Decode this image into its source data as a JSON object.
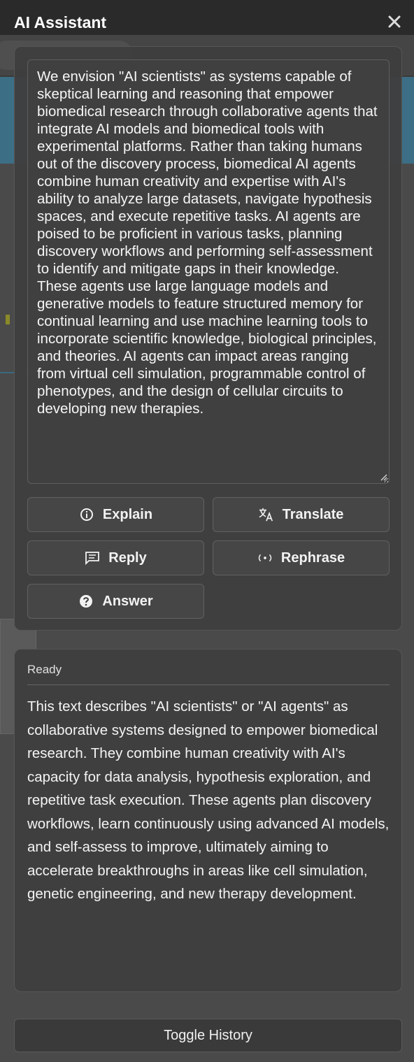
{
  "window": {
    "title": "AI Assistant",
    "close_icon": "close-icon"
  },
  "input": {
    "text": "We envision \"AI scientists\" as systems capable of skeptical learning and reasoning that empower biomedical research through collaborative agents that integrate AI models and biomedical tools with experimental platforms. Rather than taking humans out of the discovery process, biomedical AI agents combine human creativity and expertise with AI's ability to analyze large datasets, navigate hypothesis spaces, and execute repetitive tasks. AI agents are poised to be proficient in various tasks, planning discovery workflows and performing self-assessment to identify and mitigate gaps in their knowledge. These agents use large language models and generative models to feature structured memory for continual learning and use machine learning tools to incorporate scientific knowledge, biological principles, and theories. AI agents can impact areas ranging from virtual cell simulation, programmable control of phenotypes, and the design of cellular circuits to developing new therapies."
  },
  "actions": {
    "explain": {
      "label": "Explain",
      "icon": "info-icon"
    },
    "translate": {
      "label": "Translate",
      "icon": "translate-icon"
    },
    "reply": {
      "label": "Reply",
      "icon": "message-icon"
    },
    "rephrase": {
      "label": "Rephrase",
      "icon": "rephrase-icon"
    },
    "answer": {
      "label": "Answer",
      "icon": "question-icon"
    }
  },
  "output": {
    "status": "Ready",
    "text": "This text describes \"AI scientists\" or \"AI agents\" as collaborative systems designed to empower biomedical research. They combine human creativity with AI's capacity for data analysis, hypothesis exploration, and repetitive task execution. These agents plan discovery workflows, learn continuously using advanced AI models, and self-assess to improve, ultimately aiming to accelerate breakthroughs in areas like cell simulation, genetic engineering, and new therapy development."
  },
  "footer": {
    "toggle_history_label": "Toggle History"
  },
  "colors": {
    "panel_background": "#2b2b2b",
    "card_background": "#3e3e3e",
    "button_background": "#464646",
    "text": "#f2f2f2"
  }
}
